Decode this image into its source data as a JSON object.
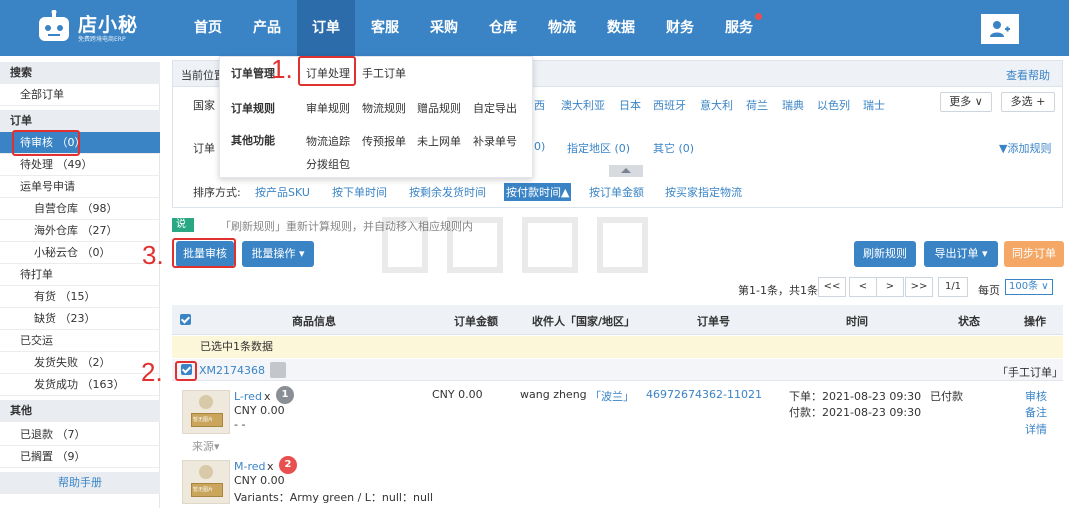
{
  "app": {
    "logo_text": "店小秘",
    "logo_sub": "免费跨境电商ERP"
  },
  "nav": {
    "items": [
      "首页",
      "产品",
      "订单",
      "客服",
      "采购",
      "仓库",
      "物流",
      "数据",
      "财务",
      "服务"
    ],
    "active": "订单"
  },
  "sidebar": {
    "search_head": "搜索",
    "all_orders": "全部订单",
    "orders_head": "订单",
    "pending_review": "待审核 （0）",
    "pending_process": "待处理 （49）",
    "tracking_apply": "运单号申请",
    "own_warehouse": "自营仓库 （98）",
    "overseas_warehouse": "海外仓库 （27）",
    "xiaomi_warehouse": "小秘云仓 （0）",
    "to_print": "待打单",
    "in_stock": "有货 （15）",
    "out_of_stock": "缺货 （23）",
    "delivered": "已交运",
    "ship_failed": "发货失败 （2）",
    "ship_success": "发货成功 （163）",
    "other_head": "其他",
    "refunded": "已退款 （7）",
    "shelved": "已搁置 （9）",
    "help_manual": "帮助手册"
  },
  "dropdown": {
    "order_mgmt": "订单管理",
    "order_process": "订单处理",
    "manual_order": "手工订单",
    "order_rules": "订单规则",
    "review_rules": "审单规则",
    "logistics_rules": "物流规则",
    "gift_rules": "赠品规则",
    "custom_export": "自定导出",
    "other_functions": "其他功能",
    "logistics_tracking": "物流追踪",
    "pre_report": "传预报单",
    "not_online": "未上网单",
    "fill_tracking": "补录单号",
    "split_pack": "分拨组包"
  },
  "filter": {
    "crumb": "当前位置",
    "help": "查看帮助",
    "country_label": "国家",
    "countries": [
      "西",
      "澳大利亚",
      "日本",
      "西班牙",
      "意大利",
      "荷兰",
      "瑞典",
      "以色列",
      "瑞士"
    ],
    "more_btn": "更多",
    "multi_btn": "多选 +",
    "order_label": "订单",
    "cat1": "0)",
    "cat2": "指定地区 (0)",
    "cat3": "其它 (0)",
    "add_rule": "添加规则",
    "sort_label": "排序方式:",
    "sort_options": [
      "按产品SKU",
      "按下单时间",
      "按剩余发货时间",
      "按付款时间",
      "按订单金额",
      "按买家指定物流"
    ]
  },
  "notice": {
    "tag": "说明!",
    "text": "「刷新规则」重新计算规则，并自动移入相应规则内"
  },
  "toolbar": {
    "batch_review": "批量审核",
    "batch_ops": "批量操作",
    "refresh_rules": "刷新规则",
    "export_orders": "导出订单",
    "sync_orders": "同步订单"
  },
  "pager": {
    "summary": "第1-1条，共1条",
    "first": "<<",
    "prev": "<",
    "next": ">",
    "last": ">>",
    "page": "1/1",
    "per_page_label": "每页",
    "per_page_value": "100条"
  },
  "table": {
    "headers": [
      "商品信息",
      "订单金额",
      "收件人「国家/地区」",
      "订单号",
      "时间",
      "状态",
      "操作"
    ],
    "selected_note": "已选中1条数据",
    "order_id": "XM2174368",
    "manual_tag": "「手工订单」",
    "item1": {
      "img_label": "暂无图片",
      "sku": "L-red",
      "qty": "x",
      "badge": "1",
      "price": "CNY 0.00",
      "extra": "- -",
      "source": "来源"
    },
    "item2": {
      "img_label": "暂无图片",
      "sku": "M-red",
      "qty": "x",
      "badge": "2",
      "price": "CNY 0.00",
      "variants": "Variants：Army green / L：null：null"
    },
    "amount": "CNY 0.00",
    "recipient": "wang zheng",
    "country": "「波兰」",
    "order_no": "46972674362-11021",
    "order_time": "下单：2021-08-23 09:30",
    "pay_time": "付款：2021-08-23 09:30",
    "status": "已付款",
    "action_review": "审核",
    "action_note": "备注",
    "action_detail": "详情"
  },
  "steps": {
    "step1": "1.",
    "step2": "2.",
    "step3": "3."
  },
  "colors": {
    "primary": "#3a84c6",
    "highlight": "#e03030",
    "orange": "#f5a866",
    "badge_grey": "#8a8f96",
    "badge_red": "#e94f4f"
  }
}
